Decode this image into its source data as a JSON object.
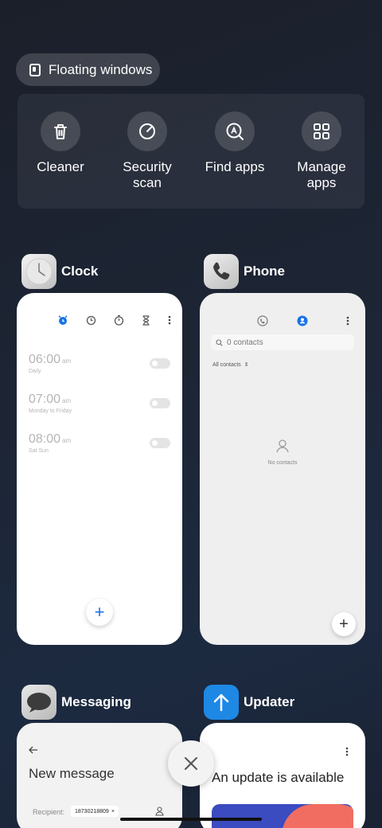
{
  "floating_windows": {
    "label": "Floating windows"
  },
  "quick_actions": [
    {
      "label_line1": "Cleaner",
      "label_line2": "",
      "icon": "trash-icon"
    },
    {
      "label_line1": "Security",
      "label_line2": "scan",
      "icon": "security-scan-icon"
    },
    {
      "label_line1": "Find apps",
      "label_line2": "",
      "icon": "find-apps-icon"
    },
    {
      "label_line1": "Manage",
      "label_line2": "apps",
      "icon": "grid-icon"
    }
  ],
  "apps": {
    "clock": {
      "name": "Clock",
      "alarms": [
        {
          "time": "06:00",
          "ampm": "am",
          "repeat": "Daily"
        },
        {
          "time": "07:00",
          "ampm": "am",
          "repeat": "Monday to Friday"
        },
        {
          "time": "08:00",
          "ampm": "am",
          "repeat": "Sat Sun"
        }
      ]
    },
    "phone": {
      "name": "Phone",
      "search_placeholder": "0 contacts",
      "filter": "All contacts",
      "empty": "No contacts"
    },
    "messaging": {
      "name": "Messaging",
      "title": "New message",
      "recipient_label": "Recipient:",
      "recipient_chip": "18730218809"
    },
    "updater": {
      "name": "Updater",
      "title": "An update is available"
    }
  },
  "colors": {
    "accent_blue": "#1a73e8",
    "updater_blue": "#1e88e5"
  }
}
